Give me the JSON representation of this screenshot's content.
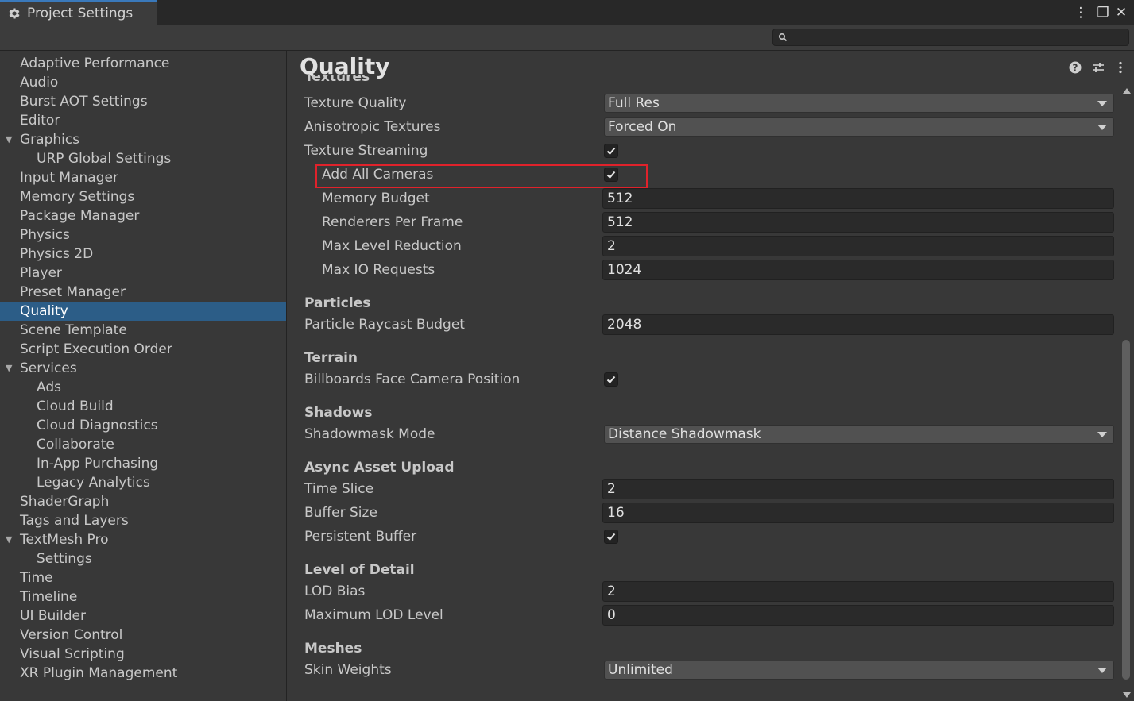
{
  "window": {
    "tab_title": "Project Settings",
    "more_glyph": "⋮",
    "maximize_glyph": "❐",
    "close_glyph": "✕",
    "search_placeholder": "",
    "search_value": ""
  },
  "sidebar": {
    "items": [
      {
        "label": "Adaptive Performance",
        "level": 0
      },
      {
        "label": "Audio",
        "level": 0
      },
      {
        "label": "Burst AOT Settings",
        "level": 0
      },
      {
        "label": "Editor",
        "level": 0
      },
      {
        "label": "Graphics",
        "level": 0,
        "expanded": true
      },
      {
        "label": "URP Global Settings",
        "level": 1
      },
      {
        "label": "Input Manager",
        "level": 0
      },
      {
        "label": "Memory Settings",
        "level": 0
      },
      {
        "label": "Package Manager",
        "level": 0
      },
      {
        "label": "Physics",
        "level": 0
      },
      {
        "label": "Physics 2D",
        "level": 0
      },
      {
        "label": "Player",
        "level": 0
      },
      {
        "label": "Preset Manager",
        "level": 0
      },
      {
        "label": "Quality",
        "level": 0,
        "selected": true
      },
      {
        "label": "Scene Template",
        "level": 0
      },
      {
        "label": "Script Execution Order",
        "level": 0
      },
      {
        "label": "Services",
        "level": 0,
        "expanded": true
      },
      {
        "label": "Ads",
        "level": 1
      },
      {
        "label": "Cloud Build",
        "level": 1
      },
      {
        "label": "Cloud Diagnostics",
        "level": 1
      },
      {
        "label": "Collaborate",
        "level": 1
      },
      {
        "label": "In-App Purchasing",
        "level": 1
      },
      {
        "label": "Legacy Analytics",
        "level": 1
      },
      {
        "label": "ShaderGraph",
        "level": 0
      },
      {
        "label": "Tags and Layers",
        "level": 0
      },
      {
        "label": "TextMesh Pro",
        "level": 0,
        "expanded": true
      },
      {
        "label": "Settings",
        "level": 1
      },
      {
        "label": "Time",
        "level": 0
      },
      {
        "label": "Timeline",
        "level": 0
      },
      {
        "label": "UI Builder",
        "level": 0
      },
      {
        "label": "Version Control",
        "level": 0
      },
      {
        "label": "Visual Scripting",
        "level": 0
      },
      {
        "label": "XR Plugin Management",
        "level": 0
      }
    ]
  },
  "main": {
    "title": "Quality",
    "cut_section": "Textures",
    "texture_quality": {
      "label": "Texture Quality",
      "value": "Full Res"
    },
    "anisotropic": {
      "label": "Anisotropic Textures",
      "value": "Forced On"
    },
    "texture_streaming": {
      "label": "Texture Streaming",
      "checked": true
    },
    "add_all_cameras": {
      "label": "Add All Cameras",
      "checked": true
    },
    "memory_budget": {
      "label": "Memory Budget",
      "value": "512"
    },
    "renderers_per_frame": {
      "label": "Renderers Per Frame",
      "value": "512"
    },
    "max_level_reduction": {
      "label": "Max Level Reduction",
      "value": "2"
    },
    "max_io_requests": {
      "label": "Max IO Requests",
      "value": "1024"
    },
    "particles": {
      "heading": "Particles",
      "raycast_label": "Particle Raycast Budget",
      "raycast_value": "2048"
    },
    "terrain": {
      "heading": "Terrain",
      "billboards_label": "Billboards Face Camera Position",
      "billboards_checked": true
    },
    "shadows": {
      "heading": "Shadows",
      "mode_label": "Shadowmask Mode",
      "mode_value": "Distance Shadowmask"
    },
    "async_upload": {
      "heading": "Async Asset Upload",
      "time_slice_label": "Time Slice",
      "time_slice_value": "2",
      "buffer_size_label": "Buffer Size",
      "buffer_size_value": "16",
      "persistent_label": "Persistent Buffer",
      "persistent_checked": true
    },
    "lod": {
      "heading": "Level of Detail",
      "bias_label": "LOD Bias",
      "bias_value": "2",
      "max_label": "Maximum LOD Level",
      "max_value": "0"
    },
    "meshes": {
      "heading": "Meshes",
      "skin_label": "Skin Weights",
      "skin_value": "Unlimited"
    }
  },
  "colors": {
    "selection": "#2c5d87",
    "highlight_box": "#e0222b",
    "background": "#383838"
  }
}
